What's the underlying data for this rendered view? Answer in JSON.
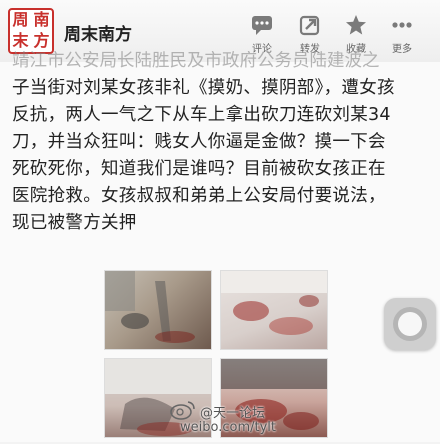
{
  "header": {
    "logo_chars": [
      "周",
      "南",
      "末",
      "方"
    ],
    "account_name": "周末南方",
    "actions": [
      {
        "label": "评论",
        "icon": "comment-icon"
      },
      {
        "label": "转发",
        "icon": "repost-icon"
      },
      {
        "label": "收藏",
        "icon": "favorite-star-icon"
      },
      {
        "label": "更多",
        "icon": "more-dots-icon"
      }
    ]
  },
  "post": {
    "cut_line": "靖江市公安局长陆胜民及市政府公务员陆建波之",
    "lines": [
      "子当街对刘某女孩非礼《摸奶、摸阴部》，遭女孩",
      "反抗，两人一气之下从车上拿出砍刀连砍刘某34",
      "刀，并当众狂叫：贱女人你逼是金做？摸一下会",
      "死砍死你，知道我们是谁吗？目前被砍女孩正在",
      "医院抢救。女孩叔叔和弟弟上公安局付要说法，",
      "现已被警方关押"
    ]
  },
  "watermark": {
    "name": "@天一论坛",
    "url": "weibo.com/tylt"
  },
  "colors": {
    "logo_red": "#c8302c",
    "icon_gray": "#7a7a7a"
  }
}
